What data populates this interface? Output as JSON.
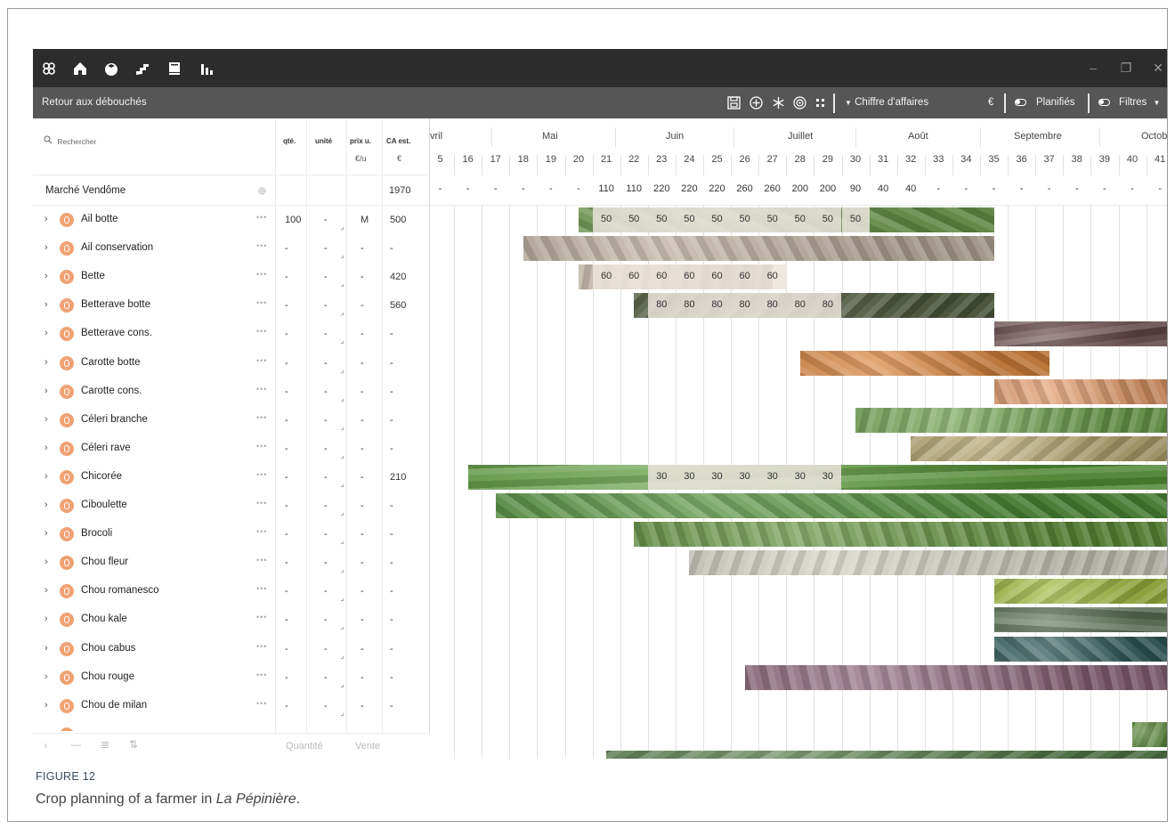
{
  "titlebar": {
    "icons": [
      "flower-icon",
      "home-icon",
      "tomato-icon",
      "stairs-icon",
      "book-icon",
      "bar-chart-icon"
    ],
    "window_controls": {
      "minimize": "–",
      "restore": "❐",
      "close": "✕"
    }
  },
  "toolbar": {
    "back_label": "Retour aux débouchés",
    "icons": [
      "save-icon",
      "add-circle-icon",
      "snowflake-icon",
      "target-icon",
      "grid-dots-icon"
    ],
    "metric_label": "Chiffre d'affaires",
    "currency": "€",
    "planned_label": "Planifiés",
    "filters_label": "Filtres"
  },
  "left": {
    "search_placeholder": "Rechercher",
    "headers": {
      "qty": "qté.",
      "unit": "unité",
      "price": "prix u.",
      "ca": "CA est."
    },
    "subheaders": {
      "price_unit": "€/u",
      "ca_unit": "€"
    },
    "group": {
      "name": "Marché Vendôme",
      "ca": "1970"
    },
    "rows": [
      {
        "name": "Ail botte",
        "qty": "100",
        "unit": "-",
        "price": "M",
        "ca": "500"
      },
      {
        "name": "Ail conservation",
        "qty": "-",
        "unit": "-",
        "price": "-",
        "ca": "-"
      },
      {
        "name": "Bette",
        "qty": "-",
        "unit": "-",
        "price": "-",
        "ca": "420"
      },
      {
        "name": "Betterave botte",
        "qty": "-",
        "unit": "-",
        "price": "-",
        "ca": "560"
      },
      {
        "name": "Betterave cons.",
        "qty": "-",
        "unit": "-",
        "price": "-",
        "ca": "-"
      },
      {
        "name": "Carotte botte",
        "qty": "-",
        "unit": "-",
        "price": "-",
        "ca": "-"
      },
      {
        "name": "Carotte cons.",
        "qty": "-",
        "unit": "-",
        "price": "-",
        "ca": "-"
      },
      {
        "name": "Céleri branche",
        "qty": "-",
        "unit": "-",
        "price": "-",
        "ca": "-"
      },
      {
        "name": "Céleri rave",
        "qty": "-",
        "unit": "-",
        "price": "-",
        "ca": "-"
      },
      {
        "name": "Chicorée",
        "qty": "-",
        "unit": "-",
        "price": "-",
        "ca": "210"
      },
      {
        "name": "Ciboulette",
        "qty": "-",
        "unit": "-",
        "price": "-",
        "ca": "-"
      },
      {
        "name": "Brocoli",
        "qty": "-",
        "unit": "-",
        "price": "-",
        "ca": "-"
      },
      {
        "name": "Chou fleur",
        "qty": "-",
        "unit": "-",
        "price": "-",
        "ca": "-"
      },
      {
        "name": "Chou romanesco",
        "qty": "-",
        "unit": "-",
        "price": "-",
        "ca": "-"
      },
      {
        "name": "Chou kale",
        "qty": "-",
        "unit": "-",
        "price": "-",
        "ca": "-"
      },
      {
        "name": "Chou cabus",
        "qty": "-",
        "unit": "-",
        "price": "-",
        "ca": "-"
      },
      {
        "name": "Chou rouge",
        "qty": "-",
        "unit": "-",
        "price": "-",
        "ca": "-"
      },
      {
        "name": "Chou de milan",
        "qty": "-",
        "unit": "-",
        "price": "-",
        "ca": "-"
      }
    ],
    "footer": {
      "quantity_label": "Quantité",
      "sale_label": "Vente"
    }
  },
  "timeline": {
    "months": [
      "vril",
      "Mai",
      "Juin",
      "Juillet",
      "Août",
      "Septembre",
      "Octobr"
    ],
    "weeks": [
      "5",
      "16",
      "17",
      "18",
      "19",
      "20",
      "21",
      "22",
      "23",
      "24",
      "25",
      "26",
      "27",
      "28",
      "29",
      "30",
      "31",
      "32",
      "33",
      "34",
      "35",
      "36",
      "37",
      "38",
      "39",
      "40",
      "41"
    ],
    "totals": [
      "-",
      "-",
      "-",
      "-",
      "-",
      "-",
      "110",
      "110",
      "220",
      "220",
      "220",
      "260",
      "260",
      "200",
      "200",
      "90",
      "40",
      "40",
      "-",
      "-",
      "-",
      "-",
      "-",
      "-",
      "-",
      "-",
      "-"
    ],
    "bars": [
      {
        "row": 0,
        "start": 5.5,
        "end": 20.5,
        "color": "#6b9a4a",
        "texture": "leek",
        "labels": [
          {
            "w": 6,
            "v": "50"
          },
          {
            "w": 7,
            "v": "50"
          },
          {
            "w": 8,
            "v": "50"
          },
          {
            "w": 9,
            "v": "50"
          },
          {
            "w": 10,
            "v": "50"
          },
          {
            "w": 11,
            "v": "50"
          },
          {
            "w": 12,
            "v": "50"
          },
          {
            "w": 13,
            "v": "50"
          },
          {
            "w": 14,
            "v": "50"
          },
          {
            "w": 15,
            "v": "50"
          }
        ]
      },
      {
        "row": 1,
        "start": 3.5,
        "end": 20.5,
        "color": "#b9ab9c",
        "texture": "garlic",
        "labels": []
      },
      {
        "row": 2,
        "start": 5.5,
        "end": 12.5,
        "color": "#cdbfae",
        "texture": "chard",
        "labels": [
          {
            "w": 6,
            "v": "60"
          },
          {
            "w": 7,
            "v": "60"
          },
          {
            "w": 8,
            "v": "60"
          },
          {
            "w": 9,
            "v": "60"
          },
          {
            "w": 10,
            "v": "60"
          },
          {
            "w": 11,
            "v": "60"
          },
          {
            "w": 12,
            "v": "60"
          }
        ]
      },
      {
        "row": 3,
        "start": 7.5,
        "end": 20.5,
        "color": "#4f5a3c",
        "texture": "beet",
        "labels": [
          {
            "w": 8,
            "v": "80"
          },
          {
            "w": 9,
            "v": "80"
          },
          {
            "w": 10,
            "v": "80"
          },
          {
            "w": 11,
            "v": "80"
          },
          {
            "w": 12,
            "v": "80"
          },
          {
            "w": 13,
            "v": "80"
          },
          {
            "w": 14,
            "v": "80"
          }
        ]
      },
      {
        "row": 4,
        "start": 20.5,
        "end": 27,
        "color": "#6a4a4c",
        "texture": "beet-store",
        "labels": []
      },
      {
        "row": 5,
        "start": 13.5,
        "end": 22.5,
        "color": "#d9843c",
        "texture": "carrot",
        "labels": []
      },
      {
        "row": 6,
        "start": 20.5,
        "end": 27,
        "color": "#e19a6a",
        "texture": "carrot-store",
        "labels": []
      },
      {
        "row": 7,
        "start": 15.5,
        "end": 27,
        "color": "#6ea04e",
        "texture": "celery",
        "labels": []
      },
      {
        "row": 8,
        "start": 17.5,
        "end": 27,
        "color": "#b5a46e",
        "texture": "celeriac",
        "labels": []
      },
      {
        "row": 9,
        "start": 1.5,
        "end": 27,
        "color": "#5c9a3a",
        "texture": "endive",
        "labels": [
          {
            "w": 8,
            "v": "30"
          },
          {
            "w": 9,
            "v": "30"
          },
          {
            "w": 10,
            "v": "30"
          },
          {
            "w": 11,
            "v": "30"
          },
          {
            "w": 12,
            "v": "30"
          },
          {
            "w": 13,
            "v": "30"
          },
          {
            "w": 14,
            "v": "30"
          }
        ]
      },
      {
        "row": 10,
        "start": 2.5,
        "end": 27,
        "color": "#4f8c36",
        "texture": "chive",
        "labels": []
      },
      {
        "row": 11,
        "start": 7.5,
        "end": 27,
        "color": "#5f8f3a",
        "texture": "broccoli",
        "labels": []
      },
      {
        "row": 12,
        "start": 9.5,
        "end": 27,
        "color": "#cfcdbf",
        "texture": "cauliflower",
        "labels": []
      },
      {
        "row": 13,
        "start": 20.5,
        "end": 27,
        "color": "#9fb83e",
        "texture": "romanesco",
        "labels": []
      },
      {
        "row": 14,
        "start": 20.5,
        "end": 27,
        "color": "#5d7656",
        "texture": "kale",
        "labels": []
      },
      {
        "row": 15,
        "start": 20.5,
        "end": 27,
        "color": "#2f5a58",
        "texture": "cabbage",
        "labels": []
      },
      {
        "row": 16,
        "start": 11.5,
        "end": 27,
        "color": "#8b6478",
        "texture": "red-cabbage",
        "labels": []
      },
      {
        "row": 18,
        "start": 25.5,
        "end": 27,
        "color": "#5d8b3e",
        "texture": "brussels",
        "labels": []
      },
      {
        "row": 19,
        "start": 6.5,
        "end": 27,
        "color": "#557d4a",
        "texture": "mixed",
        "labels": []
      }
    ]
  },
  "caption": {
    "label": "FIGURE 12",
    "text_prefix": "Crop planning of a farmer in ",
    "text_italic": "La Pépinière",
    "text_suffix": "."
  }
}
